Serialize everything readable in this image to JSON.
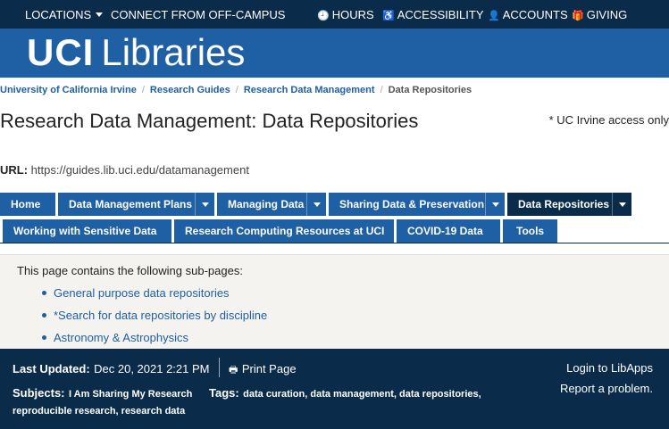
{
  "topbar": {
    "locations": "LOCATIONS",
    "off_campus": "CONNECT FROM OFF-CAMPUS",
    "hours": "HOURS",
    "accessibility": "ACCESSIBILITY",
    "accounts": "ACCOUNTS",
    "giving": "GIVING"
  },
  "banner": {
    "logo_bold": "UCI",
    "logo_light": "Libraries"
  },
  "breadcrumb": {
    "items": [
      "University of California Irvine",
      "Research Guides",
      "Research Data Management"
    ],
    "current": "Data Repositories"
  },
  "page": {
    "title": "Research Data Management: Data Repositories",
    "access_note": "* UC Irvine access only",
    "url_label": "URL:",
    "url": "https://guides.lib.uci.edu/datamanagement"
  },
  "tabs": {
    "row1": [
      "Home",
      "Data Management Plans",
      "Managing Data",
      "Sharing Data & Preservation",
      "Data Repositories"
    ],
    "row2": [
      "Working with Sensitive Data",
      "Research Computing Resources at UCI",
      "COVID-19 Data",
      "Tools"
    ],
    "active": "Data Repositories"
  },
  "subpages": {
    "intro": "This page contains the following sub-pages:",
    "items": [
      "General purpose data repositories",
      "*Search for data repositories by discipline",
      "Astronomy & Astrophysics"
    ]
  },
  "footer": {
    "last_updated_label": "Last Updated:",
    "last_updated": "Dec 20, 2021 2:21 PM",
    "print": "Print Page",
    "login": "Login to LibApps",
    "report": "Report a problem.",
    "subjects_label": "Subjects:",
    "subjects": "I Am Sharing My Research",
    "tags_label": "Tags:",
    "tags_line1": "data curation, data management, data repositories,",
    "tags_line2": "reproducible research, research data"
  }
}
